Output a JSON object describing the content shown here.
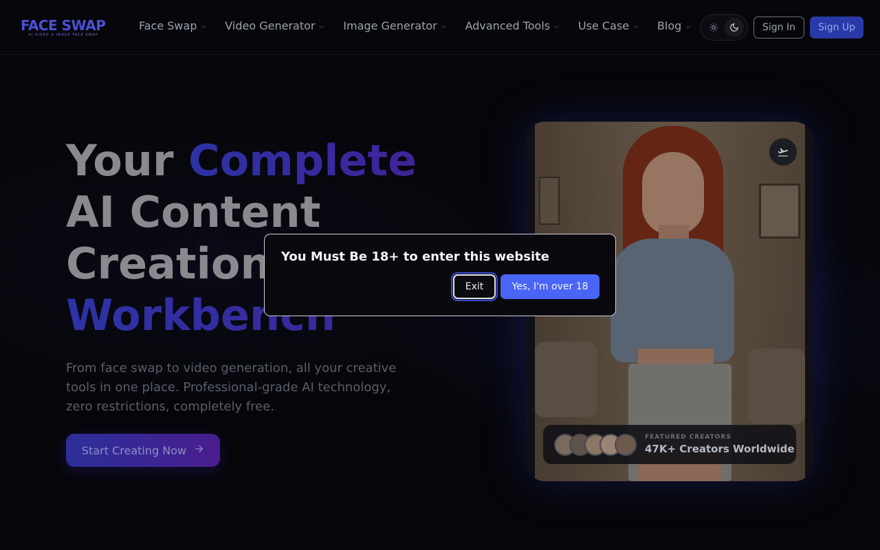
{
  "header": {
    "logo_text": "FACE SWAP",
    "logo_tagline": "AI VIDEO & IMAGE FACE SWAP",
    "nav": [
      {
        "label": "Face Swap"
      },
      {
        "label": "Video Generator"
      },
      {
        "label": "Image Generator"
      },
      {
        "label": "Advanced Tools"
      },
      {
        "label": "Use Case"
      },
      {
        "label": "Blog"
      }
    ],
    "theme_icons": [
      "sun-icon",
      "moon-icon"
    ],
    "sign_in": "Sign In",
    "sign_up": "Sign Up"
  },
  "hero": {
    "headline": {
      "word1": "Your",
      "word2": "Complete",
      "line2": "AI Content",
      "line3": "Creation",
      "line4": "Workbench"
    },
    "subtext": "From face swap to video generation, all your creative tools in one place. Professional-grade AI technology, zero restrictions, completely free.",
    "cta_label": "Start Creating Now",
    "cta_icon": "arrow-right-icon"
  },
  "card": {
    "badge_icon": "plane-icon",
    "creators_kicker": "FEATURED CREATORS",
    "creators_title": "47K+ Creators Worldwide"
  },
  "modal": {
    "title": "You Must Be 18+ to enter this website",
    "exit_label": "Exit",
    "confirm_label": "Yes, I'm over 18"
  },
  "colors": {
    "accent": "#4965f5",
    "headline_accent_start": "#2d33a6",
    "headline_accent_end": "#3f2398",
    "background": "#06060a"
  }
}
